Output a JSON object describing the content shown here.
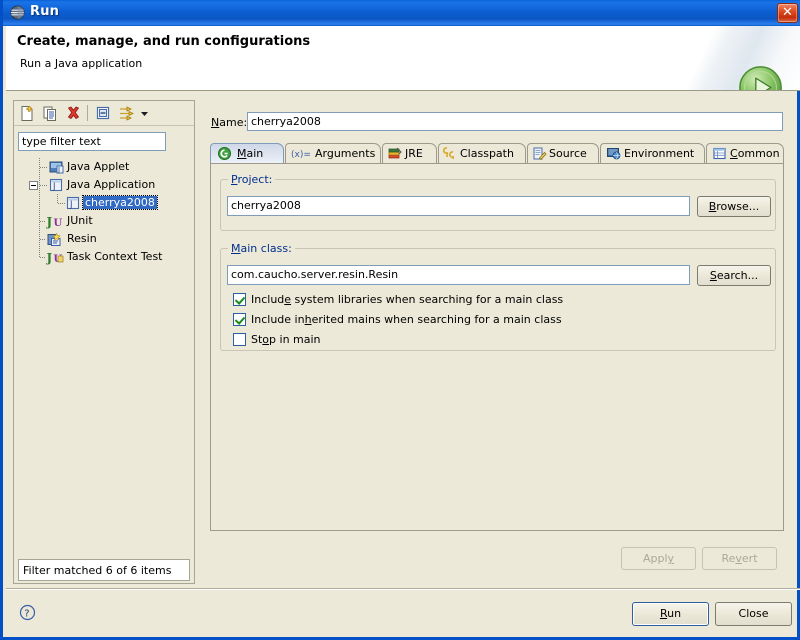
{
  "window": {
    "title": "Run",
    "icon": "eclipse-run-icon",
    "close_label": "Close window",
    "accent_titlebar": "#0b5fd0",
    "dialog_bg": "#ece9d8"
  },
  "header": {
    "title": "Create, manage, and run configurations",
    "subtitle": "Run a Java application",
    "banner_icon": "green-play-run-icon"
  },
  "left_panel": {
    "toolbar": [
      {
        "name": "new-launch-configuration-icon",
        "tooltip": "New launch configuration"
      },
      {
        "name": "duplicate-launch-configuration-icon",
        "tooltip": "Duplicate"
      },
      {
        "name": "delete-launch-configuration-icon",
        "tooltip": "Delete"
      },
      {
        "name": "collapse-all-icon",
        "tooltip": "Collapse All"
      },
      {
        "name": "filter-launch-configurations-icon",
        "tooltip": "Filter"
      },
      {
        "name": "chevron-down-icon",
        "tooltip": "View Menu"
      }
    ],
    "filter": {
      "value": "type filter text",
      "placeholder": "type filter text"
    },
    "tree": [
      {
        "label": "Java Applet",
        "icon": "java-applet-icon",
        "indent": 0,
        "selected": false,
        "expander": "none"
      },
      {
        "label": "Java Application",
        "icon": "java-application-icon",
        "indent": 0,
        "selected": false,
        "expander": "expanded"
      },
      {
        "label": "cherrya2008",
        "icon": "java-application-icon",
        "indent": 1,
        "selected": true,
        "expander": "none"
      },
      {
        "label": "JUnit",
        "icon": "junit-icon",
        "indent": 0,
        "selected": false,
        "expander": "none"
      },
      {
        "label": "Resin",
        "icon": "resin-icon",
        "indent": 0,
        "selected": false,
        "expander": "none"
      },
      {
        "label": "Task Context Test",
        "icon": "junit-task-icon",
        "indent": 0,
        "selected": false,
        "expander": "none"
      }
    ],
    "status": "Filter matched 6 of 6 items"
  },
  "right_panel": {
    "name_label": "Name:",
    "name_label_mnemonic": "N",
    "name_value": "cherrya2008",
    "tabs": [
      {
        "label": "Main",
        "icon": "main-tab-icon",
        "active": true,
        "mnemonic": "M"
      },
      {
        "label": "Arguments",
        "icon": "arguments-tab-icon",
        "active": false,
        "mnemonic": ""
      },
      {
        "label": "JRE",
        "icon": "jre-tab-icon",
        "active": false,
        "mnemonic": ""
      },
      {
        "label": "Classpath",
        "icon": "classpath-tab-icon",
        "active": false,
        "mnemonic": ""
      },
      {
        "label": "Source",
        "icon": "source-tab-icon",
        "active": false,
        "mnemonic": ""
      },
      {
        "label": "Environment",
        "icon": "environment-tab-icon",
        "active": false,
        "mnemonic": ""
      },
      {
        "label": "Common",
        "icon": "common-tab-icon",
        "active": false,
        "mnemonic": "C"
      }
    ],
    "main_tab": {
      "project_group_label": "Project:",
      "project_group_mnemonic": "P",
      "project_value": "cherrya2008",
      "browse_label": "Browse...",
      "browse_mnemonic": "B",
      "main_class_group_label": "Main class:",
      "main_class_group_mnemonic": "M",
      "main_class_value": "com.caucho.server.resin.Resin",
      "search_label": "Search...",
      "search_mnemonic": "S",
      "checkboxes": [
        {
          "label": "Include system libraries when searching for a main class",
          "checked": true,
          "mnemonic": "e"
        },
        {
          "label": "Include inherited mains when searching for a main class",
          "checked": true,
          "mnemonic": "h"
        },
        {
          "label": "Stop in main",
          "checked": false,
          "mnemonic": "o"
        }
      ]
    },
    "apply_label": "Apply",
    "apply_mnemonic": "y",
    "apply_enabled": false,
    "revert_label": "Revert",
    "revert_mnemonic": "v",
    "revert_enabled": false
  },
  "footer": {
    "help_icon": "help-question-icon",
    "run_label": "Run",
    "run_mnemonic": "R",
    "close_label": "Close"
  }
}
